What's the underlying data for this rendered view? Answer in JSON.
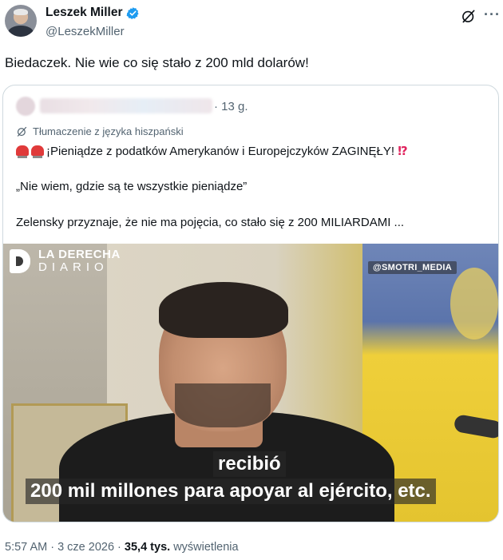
{
  "author": {
    "display_name": "Leszek Miller",
    "handle": "@LeszekMiller"
  },
  "tweet": {
    "text": "Biedaczek. Nie wie co się stało z 200 mld dolarów!"
  },
  "quote": {
    "time": "· 13 g.",
    "translation_label": "Tłumaczenie z języka hiszpański",
    "line1": "¡Pieniądze z podatków Amerykanów i Europejczyków ZAGINĘŁY! ",
    "line1_end": "⁉",
    "line2": "„Nie wiem, gdzie są te wszystkie pieniądze”",
    "line3": "Zelensky przyznaje, że nie ma pojęcia, co stało się z 200 MILIARDAMI ...",
    "media": {
      "logo_line1": "LA DERECHA",
      "logo_line2": "DIARIO",
      "watermark": "@SMOTRI_MEDIA",
      "subtitle1": "recibió",
      "subtitle2": "200 mil millones para apoyar al ejército, etc."
    }
  },
  "footer": {
    "time_date": "5:57 AM · 3 cze 2026 · ",
    "views_count": "35,4 tys.",
    "views_label": " wyświetlenia"
  },
  "colors": {
    "verified": "#1d9bf0",
    "secondary_text": "#536471",
    "border": "#cfd9de"
  },
  "icons": [
    "verified-badge-icon",
    "grok-icon",
    "more-icon",
    "translate-icon",
    "siren-icon"
  ]
}
